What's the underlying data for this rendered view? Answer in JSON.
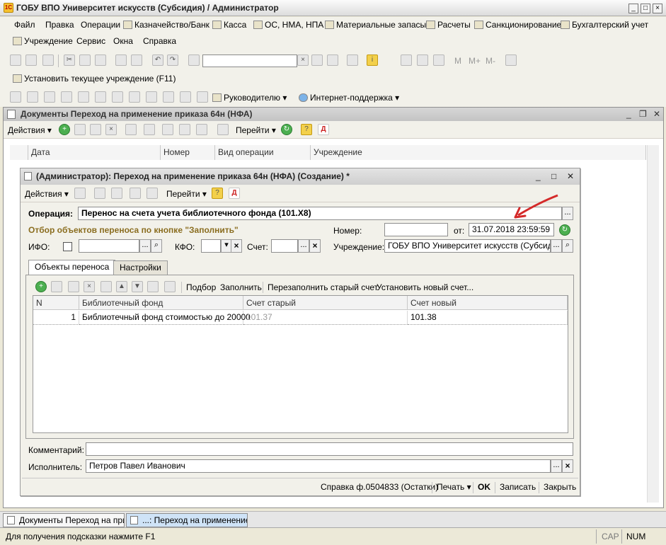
{
  "app": {
    "title": "ГОБУ ВПО Университет искусств (Субсидия) / Администратор",
    "icon_text": "1С"
  },
  "menu": {
    "row1": [
      "Файл",
      "Правка",
      "Операции",
      "Казначейство/Банк",
      "Касса",
      "ОС, НМА, НПА",
      "Материальные запасы",
      "Расчеты",
      "Санкционирование",
      "Бухгалтерский учет"
    ],
    "row2": [
      "Учреждение",
      "Сервис",
      "Окна",
      "Справка"
    ]
  },
  "toolbar": {
    "set_institution": "Установить текущее учреждение (F11)",
    "manager": "Руководителю",
    "internet_support": "Интернет-поддержка",
    "calc_buttons": [
      "M",
      "M+",
      "M-"
    ]
  },
  "list_window": {
    "title": "Документы Переход на применение приказа 64н (НФА)",
    "actions": "Действия",
    "goto": "Перейти",
    "columns": [
      "Дата",
      "Номер",
      "Вид операции",
      "Учреждение"
    ]
  },
  "form": {
    "title": "(Администратор): Переход на применение приказа 64н (НФА) (Создание) *",
    "actions": "Действия",
    "goto": "Перейти",
    "operation_label": "Операция:",
    "operation_value": "Перенос на счета учета библиотечного фонда (101.Х8)",
    "filter_heading": "Отбор объектов переноса по кнопке \"Заполнить\"",
    "number_label": "Номер:",
    "number_value": "",
    "date_label": "от:",
    "date_value": "31.07.2018 23:59:59",
    "ifo_label": "ИФО:",
    "kfo_label": "КФО:",
    "account_label": "Счет:",
    "institution_label": "Учреждение:",
    "institution_value": "ГОБУ ВПО Университет искусств (Субсидия)",
    "tabs": [
      "Объекты переноса",
      "Настройки"
    ],
    "table_toolbar": [
      "Подбор",
      "Заполнить",
      "Перезаполнить старый счет",
      "Установить новый счет..."
    ],
    "table_columns": [
      "N",
      "Библиотечный фонд",
      "Счет старый",
      "Счет новый"
    ],
    "rows": [
      {
        "n": "1",
        "fund": "Библиотечный фонд стоимостью до 20000",
        "old": "101.37",
        "new": "101.38"
      }
    ],
    "comment_label": "Комментарий:",
    "comment_value": "",
    "executor_label": "Исполнитель:",
    "executor_value": "Петров Павел Иванович",
    "footer": {
      "help": "Справка ф.0504833 (Остатки)",
      "print": "Печать",
      "ok": "OK",
      "save": "Записать",
      "close": "Закрыть"
    }
  },
  "taskbar": [
    "Документы Переход на при...",
    "...: Переход на применение ..."
  ],
  "status": {
    "hint": "Для получения подсказки нажмите F1",
    "cap": "CAP",
    "num": "NUM"
  },
  "colors": {
    "annotation_arrow": "#d42a2a",
    "operation_label_bold": "#000000",
    "filter_heading_color": "#8a6d1f"
  }
}
